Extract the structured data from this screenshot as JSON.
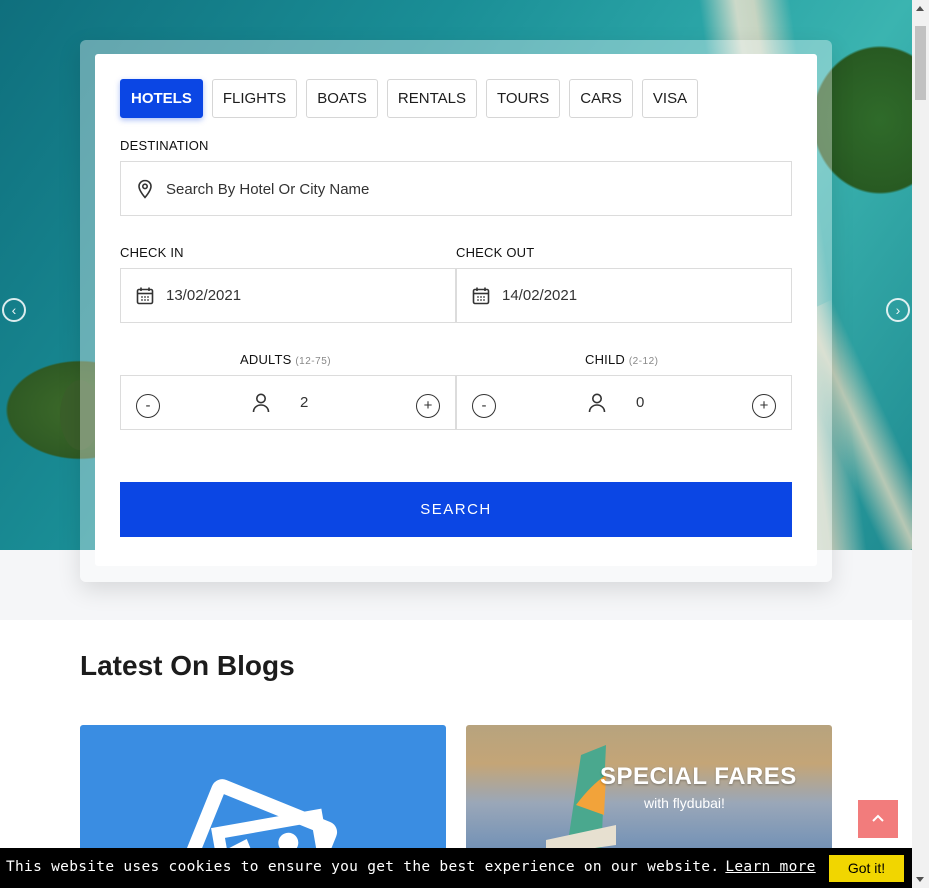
{
  "search": {
    "tabs": [
      {
        "label": "HOTELS",
        "active": true
      },
      {
        "label": "FLIGHTS",
        "active": false
      },
      {
        "label": "BOATS",
        "active": false
      },
      {
        "label": "RENTALS",
        "active": false
      },
      {
        "label": "TOURS",
        "active": false
      },
      {
        "label": "CARS",
        "active": false
      },
      {
        "label": "VISA",
        "active": false
      }
    ],
    "destination_label": "DESTINATION",
    "destination_placeholder": "Search By Hotel Or City Name",
    "checkin_label": "CHECK IN",
    "checkin_value": "13/02/2021",
    "checkout_label": "CHECK OUT",
    "checkout_value": "14/02/2021",
    "adults_label": "ADULTS",
    "adults_range": "(12-75)",
    "adults_value": "2",
    "child_label": "CHILD",
    "child_range": "(2-12)",
    "child_value": "0",
    "minus": "-",
    "plus": "+",
    "search_button": "SEARCH"
  },
  "slider": {
    "prev_icon": "chevron-left-icon",
    "next_icon": "chevron-right-icon"
  },
  "blogs": {
    "title": "Latest On Blogs",
    "card2_headline": "SPECIAL FARES",
    "card2_sub": "with flydubai!"
  },
  "cookie": {
    "message": "This website uses cookies to ensure you get the best experience on our website.",
    "learn_more": "Learn more",
    "accept": "Got it!"
  },
  "colors": {
    "accent": "#0b46e4",
    "scroll_top": "#f27c7c",
    "cookie_button": "#f1d600"
  }
}
